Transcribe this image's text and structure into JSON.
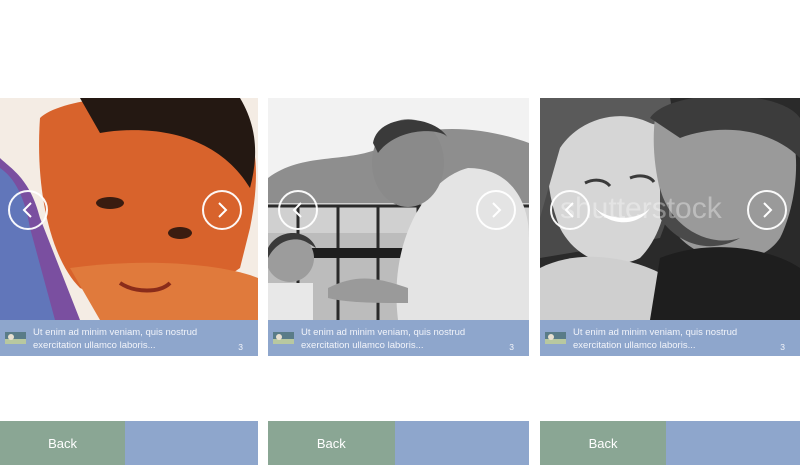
{
  "slides": [
    {
      "caption": "Ut enim ad minim veniam, quis nostrud exercitation ullamco laboris...",
      "page_number": "3",
      "back_label": "Back",
      "photo_icon": "boy-portrait-photo"
    },
    {
      "caption": "Ut enim ad minim veniam, quis nostrud exercitation ullamco laboris...",
      "page_number": "3",
      "back_label": "Back",
      "photo_icon": "father-and-child-drawing-photo"
    },
    {
      "caption": "Ut enim ad minim veniam, quis nostrud exercitation ullamco laboris...",
      "page_number": "3",
      "back_label": "Back",
      "photo_icon": "couple-hugging-photo",
      "watermark": "shutterstock"
    }
  ],
  "icons": {
    "prev": "chevron-left-icon",
    "next": "chevron-right-icon"
  },
  "colors": {
    "caption_bar": "#8ea6cc",
    "back_button": "#8aa694",
    "next_button": "#8ea6cc"
  }
}
